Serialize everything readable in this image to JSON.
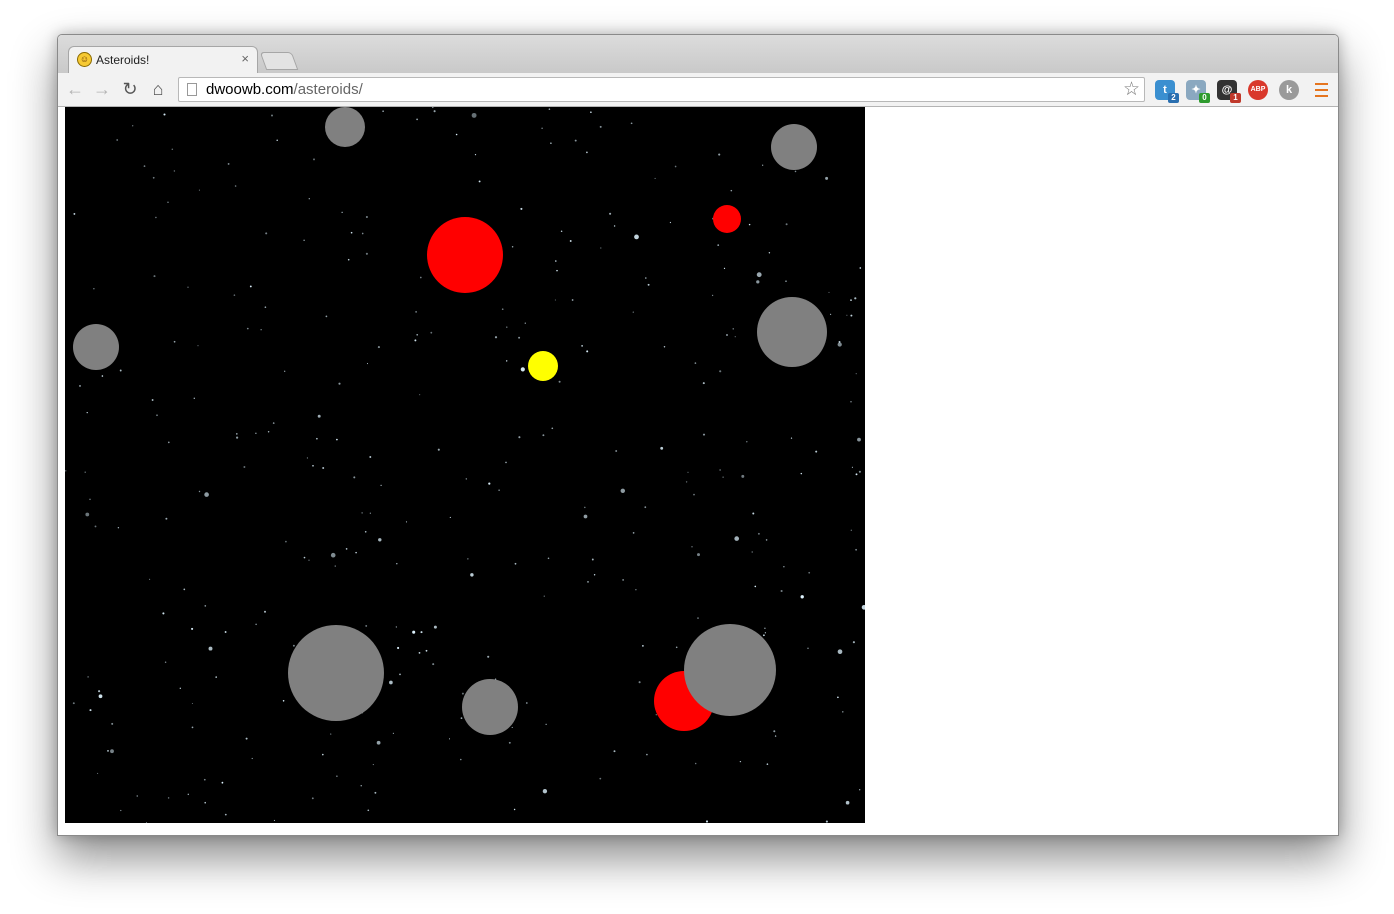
{
  "browser": {
    "tab": {
      "title": "Asteroids!",
      "favicon": "smiley-face-icon",
      "close_glyph": "×"
    },
    "address_bar": {
      "domain": "dwoowb.com",
      "path": "/asteroids/"
    },
    "nav": {
      "back": "←",
      "forward": "→",
      "reload": "↻",
      "home": "⌂"
    },
    "bookmark_star": "☆",
    "extensions": [
      {
        "name": "twitter-extension-icon",
        "glyph": "t",
        "badge": "2",
        "color": "#3a8fd0",
        "badge_color": "#2a6fb0"
      },
      {
        "name": "translate-extension-icon",
        "glyph": "✦",
        "badge": "0",
        "color": "#8aa8c0",
        "badge_color": "#2e9b2e"
      },
      {
        "name": "mail-at-extension-icon",
        "glyph": "@",
        "badge": "1",
        "color": "#333333",
        "badge_color": "#c0392b"
      },
      {
        "name": "adblock-plus-icon",
        "glyph": "ABP",
        "badge": "",
        "color": "#d9382b",
        "badge_color": ""
      },
      {
        "name": "klout-extension-icon",
        "glyph": "k",
        "badge": "",
        "color": "#9a9a9a",
        "badge_color": ""
      }
    ],
    "menu_icon_color": "#e5751f"
  },
  "game": {
    "background": "#000000",
    "asteroid_color": "#808080",
    "enemy_color": "#ff0000",
    "ship_color": "#ffff00",
    "star_color": "#dff4ff"
  }
}
